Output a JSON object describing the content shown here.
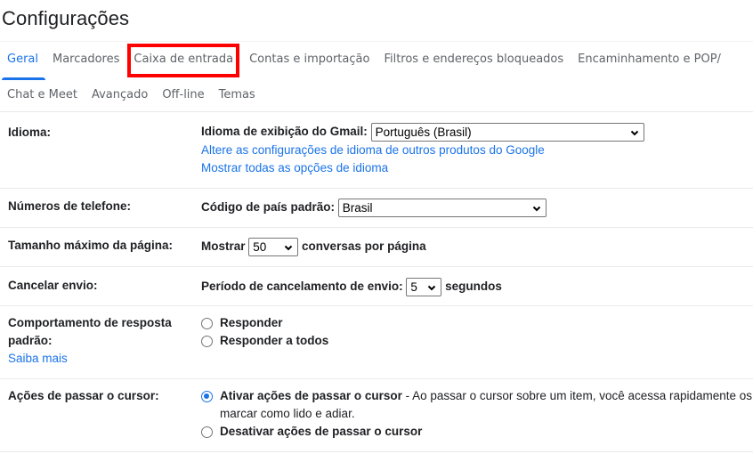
{
  "page": {
    "title": "Configurações"
  },
  "tabs": {
    "row1": [
      {
        "label": "Geral",
        "active": true
      },
      {
        "label": "Marcadores"
      },
      {
        "label": "Caixa de entrada",
        "highlighted": true
      },
      {
        "label": "Contas e importação"
      },
      {
        "label": "Filtros e endereços bloqueados"
      },
      {
        "label": "Encaminhamento e POP/"
      }
    ],
    "row2": [
      {
        "label": "Chat e Meet"
      },
      {
        "label": "Avançado"
      },
      {
        "label": "Off-line"
      },
      {
        "label": "Temas"
      }
    ],
    "highlight_color": "#ff0000",
    "active_color": "#1a73e8"
  },
  "sections": {
    "language": {
      "label": "Idioma:",
      "field_label": "Idioma de exibição do Gmail:",
      "selected": "Português (Brasil)",
      "link1": "Altere as configurações de idioma de outros produtos do Google",
      "link2": "Mostrar todas as opções de idioma"
    },
    "phone": {
      "label": "Números de telefone:",
      "field_label": "Código de país padrão:",
      "selected": "Brasil"
    },
    "page_size": {
      "label": "Tamanho máximo da página:",
      "prefix": "Mostrar",
      "selected": "50",
      "suffix": "conversas por página"
    },
    "undo_send": {
      "label": "Cancelar envio:",
      "field_label": "Período de cancelamento de envio:",
      "selected": "5",
      "suffix": "segundos"
    },
    "reply": {
      "label": "Comportamento de resposta padrão:",
      "learn_more": "Saiba mais",
      "options": [
        {
          "label": "Responder",
          "checked": false
        },
        {
          "label": "Responder a todos",
          "checked": false
        }
      ]
    },
    "hover": {
      "label": "Ações de passar o cursor:",
      "option1_label": "Ativar ações de passar o cursor",
      "option1_desc": " - Ao passar o cursor sobre um item, você acessa rapidamente os controles de arquivar, excluir,",
      "option1_desc_line2": "marcar como lido e adiar.",
      "option1_checked": true,
      "option2_label": "Desativar ações de passar o cursor",
      "option2_checked": false
    }
  }
}
